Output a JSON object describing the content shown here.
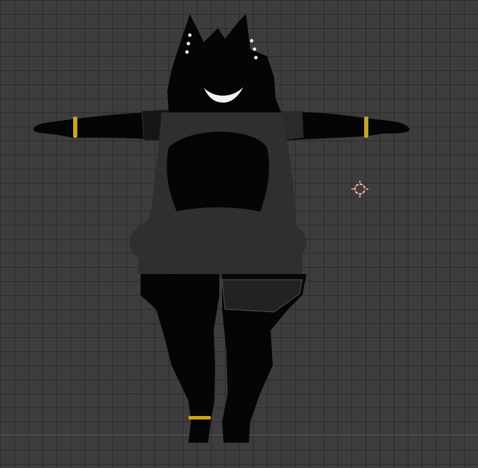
{
  "viewport": {
    "background_color": "#3d3d3d",
    "grid_line_color": "#2f2f2f",
    "x_axis_color": "#a5474f",
    "cursor_color": "#e0e0e0",
    "cursor_accent_color": "#c93c3c"
  },
  "model": {
    "description_icon": "3d-character-model-icon",
    "body_color": "#050505",
    "clothing_color": "#2f2f2f",
    "accessory_color": "#c9a227",
    "pose": "t-pose",
    "view": "front-orthographic"
  },
  "icons": [
    "3d-cursor-icon"
  ]
}
